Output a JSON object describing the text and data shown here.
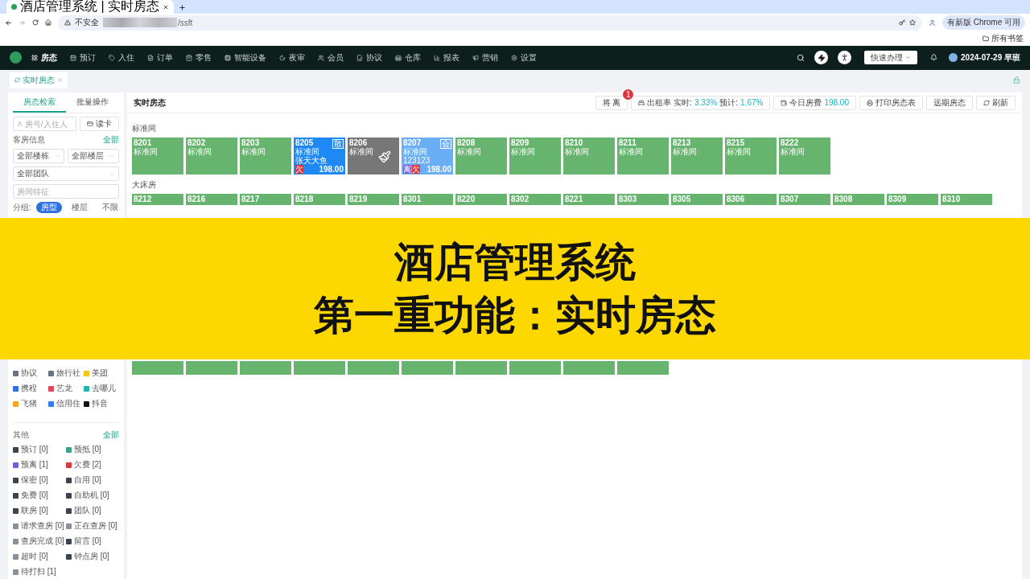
{
  "browser": {
    "tab_title": "酒店管理系统 | 实时房态",
    "security": "不安全",
    "url": "/ssft",
    "update": "有新版 Chrome 可用",
    "bookmarks": "所有书签"
  },
  "nav": {
    "items": [
      {
        "label": "房态",
        "selected": true
      },
      {
        "label": "预订",
        "selected": false
      },
      {
        "label": "入住",
        "selected": false
      },
      {
        "label": "订单",
        "selected": false
      },
      {
        "label": "零售",
        "selected": false
      },
      {
        "label": "智能设备",
        "selected": false
      },
      {
        "label": "夜审",
        "selected": false
      },
      {
        "label": "会员",
        "selected": false
      },
      {
        "label": "协议",
        "selected": false
      },
      {
        "label": "仓库",
        "selected": false
      },
      {
        "label": "报表",
        "selected": false
      },
      {
        "label": "营销",
        "selected": false
      },
      {
        "label": "设置",
        "selected": false
      }
    ],
    "quick": "快速办理",
    "date": "2024-07-29 早班"
  },
  "page_tab": "实时房态",
  "sidebar": {
    "tabs": [
      {
        "label": "房态检索",
        "selected": true
      },
      {
        "label": "批量操作",
        "selected": false
      }
    ],
    "search_placeholder": "房号/入住人",
    "read_card": "读卡",
    "room_info": "客房信息",
    "all": "全部",
    "selects": [
      "全部楼栋",
      "全部楼层",
      "全部团队"
    ],
    "feature_placeholder": "房间特征",
    "group_label": "分组:",
    "groups": [
      {
        "label": "房型",
        "selected": true
      },
      {
        "label": "楼层",
        "selected": false
      },
      {
        "label": "不限",
        "selected": false
      }
    ],
    "channels": [
      {
        "label": "协议",
        "color": "#6b7280"
      },
      {
        "label": "旅行社",
        "color": "#6b7280"
      },
      {
        "label": "美团",
        "color": "#f5c518"
      },
      {
        "label": "携程",
        "color": "#2f6fe0"
      },
      {
        "label": "艺龙",
        "color": "#e0455a"
      },
      {
        "label": "去哪儿",
        "color": "#1fb5b5"
      },
      {
        "label": "飞猪",
        "color": "#f5a623"
      },
      {
        "label": "信用住",
        "color": "#2f7df0"
      },
      {
        "label": "抖音",
        "color": "#111111"
      }
    ],
    "other_title": "其他",
    "other_all": "全部",
    "others": [
      {
        "label": "预订 [0]",
        "color": "#3d4450"
      },
      {
        "label": "预抵 [0]",
        "color": "#3aa08a"
      },
      {
        "label": "预离 [1]",
        "color": "#7b5cd6"
      },
      {
        "label": "欠费 [2]",
        "color": "#d9363e"
      },
      {
        "label": "保密 [0]",
        "color": "#3d4450"
      },
      {
        "label": "自用 [0]",
        "color": "#3d4450"
      },
      {
        "label": "免费 [0]",
        "color": "#3d4450"
      },
      {
        "label": "自助机 [0]",
        "color": "#3d4450"
      },
      {
        "label": "联房 [0]",
        "color": "#3d4450"
      },
      {
        "label": "团队 [0]",
        "color": "#3d4450"
      },
      {
        "label": "请求查房 [0]",
        "color": "#8a8f99"
      },
      {
        "label": "正在查房 [0]",
        "color": "#8a8f99"
      },
      {
        "label": "查房完成 [0]",
        "color": "#8a8f99"
      },
      {
        "label": "留言 [0]",
        "color": "#3d4450"
      },
      {
        "label": "超时 [0]",
        "color": "#8a8f99"
      },
      {
        "label": "钟点房 [0]",
        "color": "#3d4450"
      },
      {
        "label": "待打扫 [1]",
        "color": "#8a8f99"
      }
    ]
  },
  "content": {
    "title": "实时房态",
    "leaving": {
      "label": "将 离",
      "badge": "1"
    },
    "occupancy": {
      "label": "出租率 实时:",
      "now": "3.33%",
      "forecast_label": "预计:",
      "forecast": "1.67%"
    },
    "fee": {
      "label": "今日房费",
      "value": "198.00"
    },
    "print": "打印房态表",
    "future": "远期房态",
    "refresh": "刷新",
    "groups": [
      {
        "label": "标准间",
        "rooms": [
          {
            "number": "8201",
            "type": "标准间",
            "kind": "vacant"
          },
          {
            "number": "8202",
            "type": "标准间",
            "kind": "vacant"
          },
          {
            "number": "8203",
            "type": "标准间",
            "kind": "vacant"
          },
          {
            "number": "8205",
            "type": "标准间",
            "kind": "occupied",
            "guest": "张天大鱼",
            "corner": "散",
            "tags": [
              {
                "label": "欠",
                "color": "#d9363e"
              }
            ],
            "price": "198.00"
          },
          {
            "number": "8206",
            "type": "标准间",
            "kind": "dirty"
          },
          {
            "number": "8207",
            "type": "标准间",
            "kind": "reserved",
            "guest": "123123",
            "corner": "会",
            "tags": [
              {
                "label": "离",
                "color": "#7b5cd6"
              },
              {
                "label": "欠",
                "color": "#d9363e"
              }
            ],
            "price": "198.00"
          },
          {
            "number": "8208",
            "type": "标准间",
            "kind": "vacant"
          },
          {
            "number": "8209",
            "type": "标准间",
            "kind": "vacant"
          },
          {
            "number": "8210",
            "type": "标准间",
            "kind": "vacant"
          },
          {
            "number": "8211",
            "type": "标准间",
            "kind": "vacant"
          },
          {
            "number": "8213",
            "type": "标准间",
            "kind": "vacant"
          },
          {
            "number": "8215",
            "type": "标准间",
            "kind": "vacant"
          },
          {
            "number": "8222",
            "type": "标准间",
            "kind": "vacant"
          }
        ]
      },
      {
        "label": "大床房",
        "rooms": [
          {
            "number": "8212",
            "kind": "vacant"
          },
          {
            "number": "8216",
            "kind": "vacant"
          },
          {
            "number": "8217",
            "kind": "vacant"
          },
          {
            "number": "8218",
            "kind": "vacant"
          },
          {
            "number": "8219",
            "kind": "vacant"
          },
          {
            "number": "8301",
            "kind": "vacant"
          },
          {
            "number": "8220",
            "kind": "vacant"
          },
          {
            "number": "8302",
            "kind": "vacant"
          },
          {
            "number": "8221",
            "kind": "vacant"
          },
          {
            "number": "8303",
            "kind": "vacant"
          },
          {
            "number": "8305",
            "kind": "vacant"
          },
          {
            "number": "8306",
            "kind": "vacant"
          },
          {
            "number": "8307",
            "kind": "vacant"
          },
          {
            "number": "8308",
            "kind": "vacant"
          },
          {
            "number": "8309",
            "kind": "vacant"
          },
          {
            "number": "8310",
            "kind": "vacant"
          }
        ]
      },
      {
        "rooms": [
          {
            "kind": "vacant"
          },
          {
            "kind": "vacant"
          },
          {
            "kind": "vacant"
          },
          {
            "kind": "vacant"
          },
          {
            "kind": "vacant"
          },
          {
            "kind": "vacant"
          },
          {
            "kind": "vacant"
          },
          {
            "kind": "vacant"
          },
          {
            "kind": "vacant"
          },
          {
            "kind": "vacant"
          }
        ]
      }
    ]
  },
  "banner": {
    "lines": [
      "酒店管理系统",
      "第一重功能：实时房态"
    ]
  }
}
